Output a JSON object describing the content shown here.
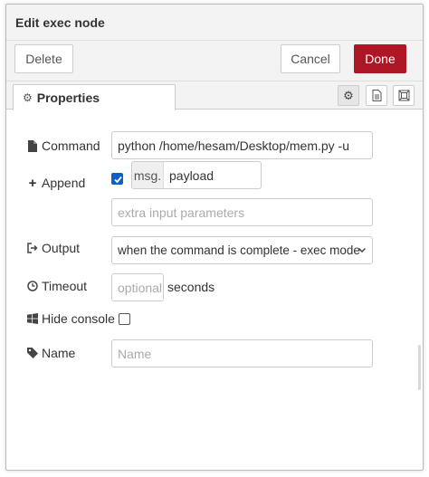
{
  "dialog": {
    "title": "Edit exec node"
  },
  "toolbar": {
    "delete_label": "Delete",
    "cancel_label": "Cancel",
    "done_label": "Done"
  },
  "tabs": {
    "properties_label": "Properties"
  },
  "form": {
    "command": {
      "label": "Command",
      "value": "python /home/hesam/Desktop/mem.py -u"
    },
    "append": {
      "label": "Append",
      "checked": true,
      "type": "msg.",
      "value": "payload",
      "extra_placeholder": "extra input parameters"
    },
    "output": {
      "label": "Output",
      "selected": "when the command is complete - exec mode"
    },
    "timeout": {
      "label": "Timeout",
      "placeholder": "optional",
      "unit": "seconds"
    },
    "hide_console": {
      "label": "Hide console",
      "checked": false
    },
    "name": {
      "label": "Name",
      "placeholder": "Name"
    }
  },
  "colors": {
    "primary": "#ad1625",
    "checkbox": "#0b61c8",
    "header_bg": "#f3f3f3"
  }
}
